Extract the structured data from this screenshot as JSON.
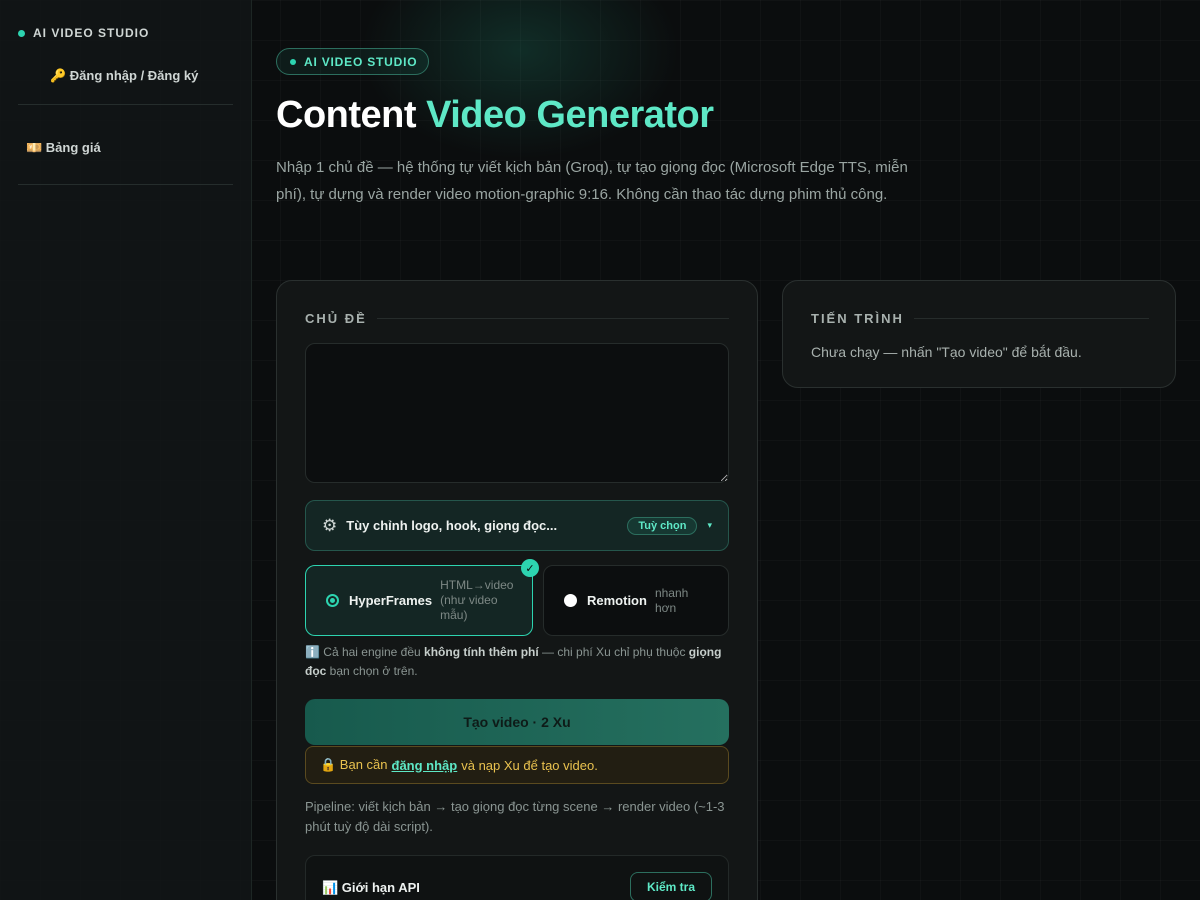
{
  "sidebar": {
    "brand": "AI VIDEO STUDIO",
    "login": "🔑 Đăng nhập / Đăng ký",
    "pricing": "💴 Bảng giá"
  },
  "header": {
    "pill": "AI VIDEO STUDIO",
    "title_main": "Content ",
    "title_accent": "Video Generator",
    "description": "Nhập 1 chủ đề — hệ thống tự viết kịch bản (Groq), tự tạo giọng đọc (Microsoft Edge TTS, miễn phí), tự dựng và render video motion-graphic 9:16. Không cần thao tác dựng phim thủ công."
  },
  "form": {
    "section_label": "CHỦ ĐỀ",
    "topic_value": "",
    "customize": {
      "icon": "gear-icon",
      "label": "Tùy chỉnh logo, hook, giọng đọc...",
      "badge": "Tuỳ chọn",
      "chevron": "▾"
    },
    "engines": [
      {
        "name": "HyperFrames",
        "desc": "HTML→video (như video mẫu)",
        "selected": true
      },
      {
        "name": "Remotion",
        "desc": "nhanh hơn",
        "selected": false
      }
    ],
    "note": {
      "icon": "ℹ️",
      "part1": " Cả hai engine đều ",
      "bold1": "không tính thêm phí",
      "part2": " — chi phí Xu chỉ phụ thuộc ",
      "bold2": "giọng đọc",
      "part3": " bạn chọn ở trên."
    },
    "create_button": "Tạo video · 2 Xu",
    "warning": {
      "prefix": "🔒 Bạn cần",
      "link": "đăng nhập",
      "suffix": "và nạp Xu để tạo video."
    },
    "pipeline": "Pipeline: viết kịch bản → tạo giọng đọc từng scene → render video (~1-3 phút tuỳ độ dài script).",
    "api": {
      "title": "📊 Giới hạn API",
      "button": "Kiểm tra"
    }
  },
  "progress": {
    "section_label": "TIẾN TRÌNH",
    "status": "Chưa chạy — nhấn \"Tạo video\" để bắt đầu."
  },
  "colors": {
    "accent": "#2dd4b0",
    "accent_text": "#5ee8c6",
    "warning": "#e9c24f",
    "background": "#0b0d0e"
  }
}
